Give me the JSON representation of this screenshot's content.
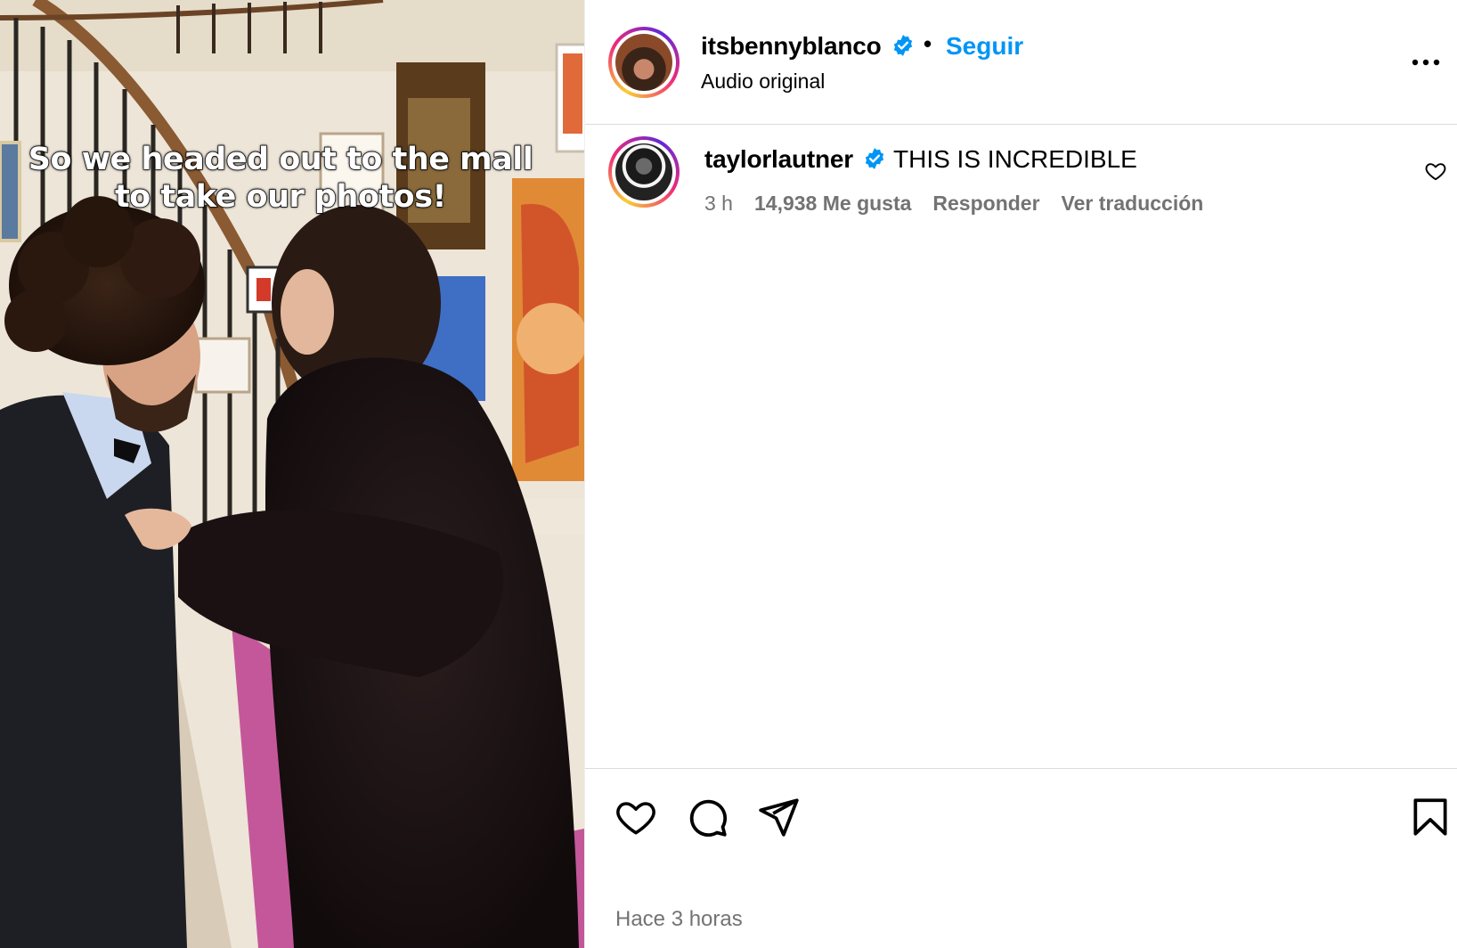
{
  "media": {
    "caption_line1": "So we headed out to the mall",
    "caption_line2": "to take our photos!"
  },
  "post_header": {
    "username": "itsbennyblanco",
    "separator": "•",
    "follow_label": "Seguir",
    "audio_label": "Audio original",
    "more_icon": "more-options-icon"
  },
  "comment": {
    "username": "taylorlautner",
    "text": "THIS IS INCREDIBLE",
    "time": "3 h",
    "likes": "14,938 Me gusta",
    "reply_label": "Responder",
    "translate_label": "Ver traducción"
  },
  "actions": {
    "like_icon": "heart-icon",
    "comment_icon": "comment-icon",
    "share_icon": "send-icon",
    "save_icon": "bookmark-icon"
  },
  "timestamp": "Hace 3 horas",
  "colors": {
    "accent": "#0095f6",
    "verified": "#0095f6",
    "muted": "#737373",
    "divider": "#dbdbdb"
  }
}
